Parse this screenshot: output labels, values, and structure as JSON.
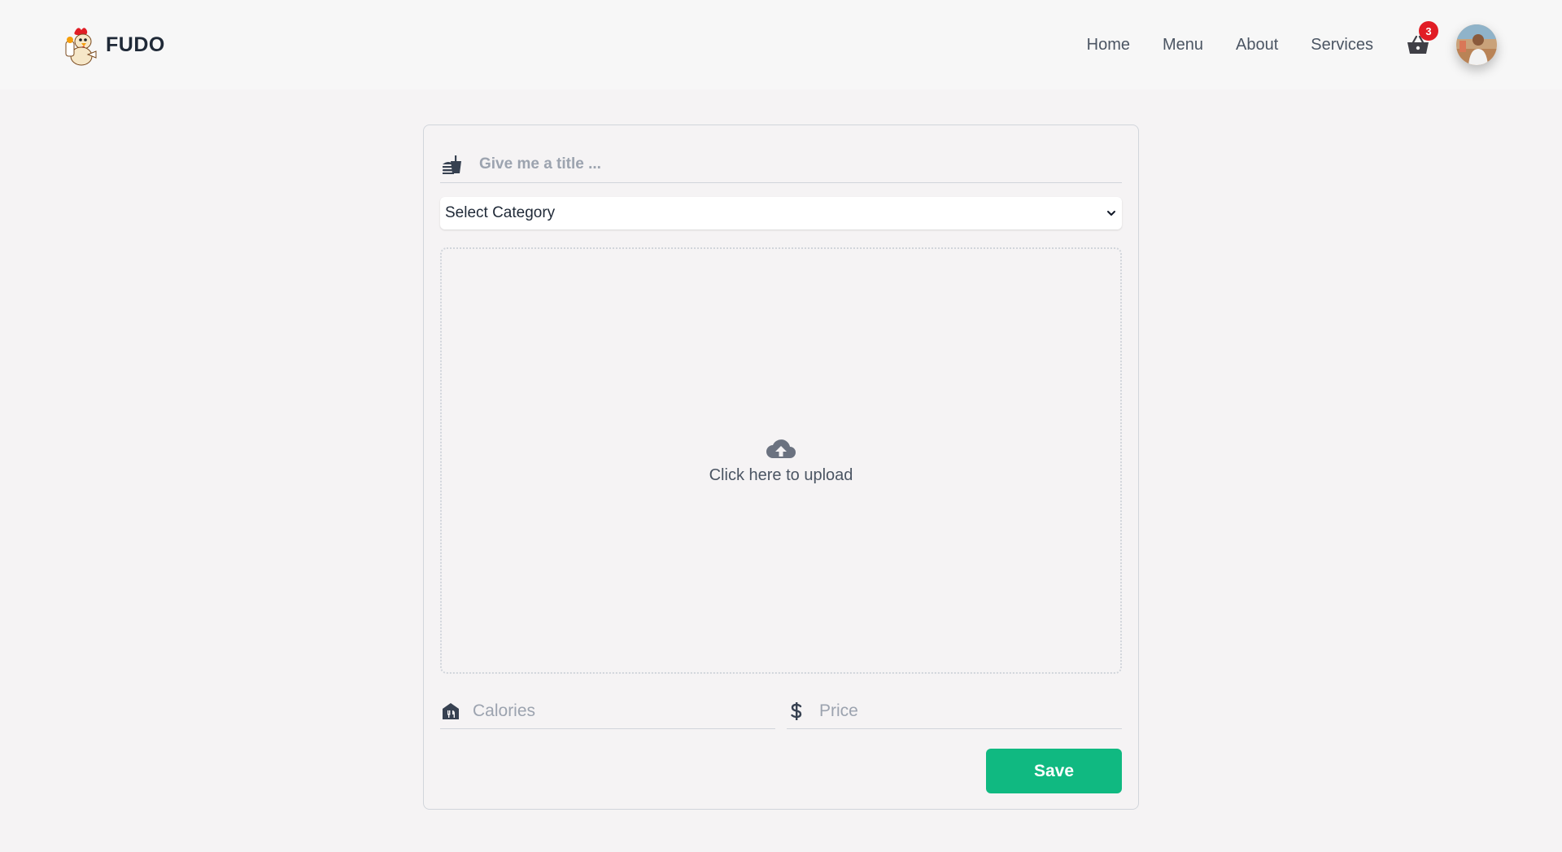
{
  "brand": {
    "name": "FUDO",
    "logo_icon": "chicken-chef-logo"
  },
  "nav": {
    "links": [
      "Home",
      "Menu",
      "About",
      "Services"
    ],
    "cart": {
      "icon": "shopping-basket-icon",
      "count": "3"
    },
    "avatar_icon": "user-avatar"
  },
  "form": {
    "title_placeholder": "Give me a title ...",
    "title_icon": "fastfood-icon",
    "category": {
      "selected": "Select Category"
    },
    "upload": {
      "icon": "cloud-upload-icon",
      "text": "Click here to upload"
    },
    "calories_placeholder": "Calories",
    "calories_icon": "food-bank-icon",
    "price_placeholder": "Price",
    "price_icon": "dollar-icon",
    "save_label": "Save"
  },
  "colors": {
    "accent": "#10b981",
    "badge": "#e11d25",
    "background": "#f5f3f4",
    "header": "#f7f7f7"
  }
}
